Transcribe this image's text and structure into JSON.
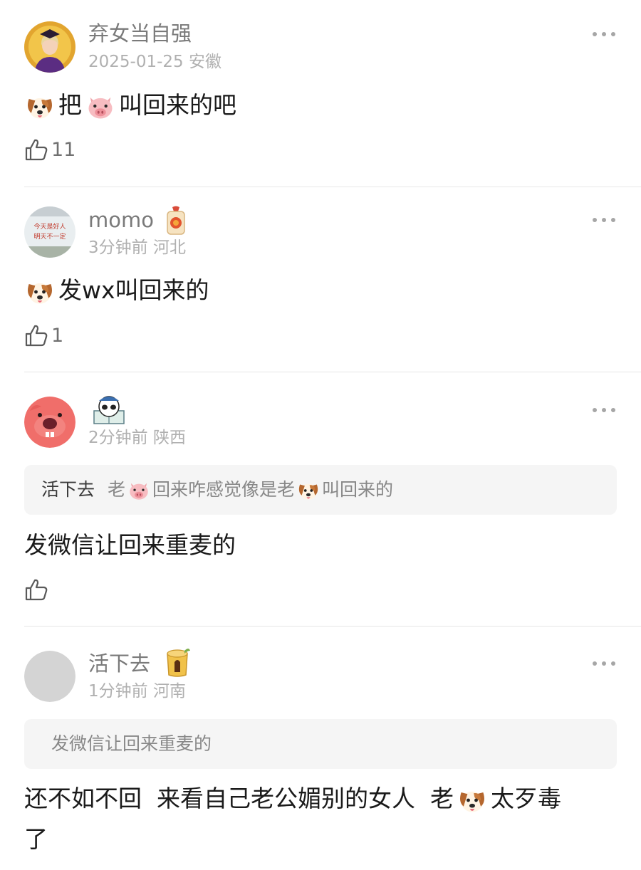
{
  "comments": [
    {
      "username": "弃女当自强",
      "date": "2025-01-25",
      "location": "安徽",
      "text_parts": [
        "把",
        "叫回来的吧"
      ],
      "likes": "11"
    },
    {
      "username": "momo",
      "avatar_text_line1": "今天是好人",
      "avatar_text_line2": "明天不一定",
      "date": "3分钟前",
      "location": "河北",
      "text_parts": [
        "发wx叫回来的"
      ],
      "likes": "1"
    },
    {
      "username": "",
      "date": "2分钟前",
      "location": "陕西",
      "quote_name": "活下去",
      "quote_parts": [
        "老",
        "回来咋感觉像是老",
        "叫回来的"
      ],
      "text": "发微信让回来重麦的",
      "likes": ""
    },
    {
      "username": "活下去",
      "date": "1分钟前",
      "location": "河南",
      "quote_text": "发微信让回来重麦的",
      "text_line1_parts": [
        "还不如不回  来看自己老公媚别的女人  老",
        "太歹毒"
      ],
      "text_line2": "了"
    }
  ],
  "colors": {
    "username": "#7a7a7a",
    "meta": "#b0b0b0",
    "body": "#1a1a1a",
    "divider": "#e6e6e6",
    "quote_bg": "#f5f5f5"
  },
  "icons": [
    "dog-face-emoji",
    "pig-face-emoji",
    "thumbs-up-icon",
    "more-options-icon",
    "amulet-badge",
    "stump-badge",
    "panda-sticker"
  ]
}
